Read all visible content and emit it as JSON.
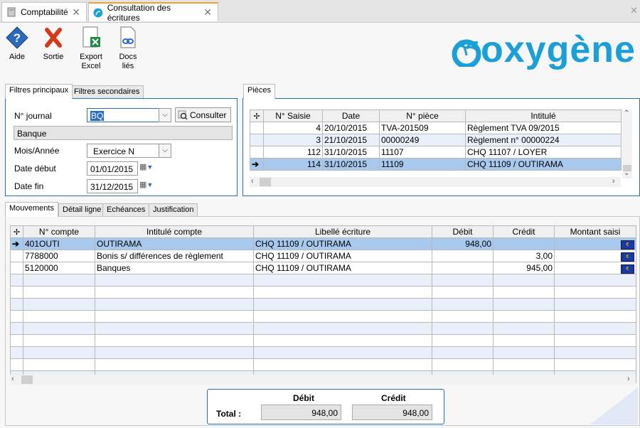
{
  "tabs": [
    {
      "label": "Comptabilité",
      "close": "✕"
    },
    {
      "label": "Consultation des écritures",
      "close": "✕"
    }
  ],
  "toolbar": [
    {
      "label1": "Aide",
      "label2": ""
    },
    {
      "label1": "Sortie",
      "label2": ""
    },
    {
      "label1": "Export",
      "label2": "Excel"
    },
    {
      "label1": "Docs",
      "label2": "liés"
    }
  ],
  "logo": "oxygène",
  "filters": {
    "tab_main": "Filtres principaux",
    "tab_secondary": "Filtres secondaires",
    "journal_label": "N° journal",
    "journal_value": "BQ",
    "consult_label": "Consulter",
    "journal_name": "Banque",
    "period_label": "Mois/Année",
    "period_value": "Exercice N",
    "start_label": "Date début",
    "start_value": "01/01/2015",
    "end_label": "Date fin",
    "end_value": "31/12/2015"
  },
  "pieces": {
    "tab": "Pièces",
    "headers": [
      "N° Saisie",
      "Date",
      "N° pièce",
      "Intitulé"
    ],
    "rows": [
      {
        "saisie": "4",
        "date": "20/10/2015",
        "piece": "TVA-201509",
        "intitule": "Règlement TVA 09/2015"
      },
      {
        "saisie": "3",
        "date": "21/10/2015",
        "piece": "00000249",
        "intitule": "Règlement n° 00000224"
      },
      {
        "saisie": "112",
        "date": "31/10/2015",
        "piece": "11107",
        "intitule": "CHQ 11107 / LOYER"
      },
      {
        "saisie": "114",
        "date": "31/10/2015",
        "piece": "11109",
        "intitule": "CHQ 11109 / OUTIRAMA"
      }
    ]
  },
  "lower_tabs": [
    "Mouvements",
    "Détail ligne",
    "Echéances",
    "Justification"
  ],
  "movements": {
    "headers": [
      "N° compte",
      "Intitulé compte",
      "Libellé écriture",
      "Débit",
      "Crédit",
      "Montant saisi"
    ],
    "rows": [
      {
        "compte": "401OUTI",
        "intitule": "OUTIRAMA",
        "libelle": "CHQ 11109 / OUTIRAMA",
        "debit": "948,00",
        "credit": ""
      },
      {
        "compte": "7788000",
        "intitule": "Bonis s/ différences de règlement",
        "libelle": "CHQ 11109 / OUTIRAMA",
        "debit": "",
        "credit": "3,00"
      },
      {
        "compte": "5120000",
        "intitule": "Banques",
        "libelle": "CHQ 11109 / OUTIRAMA",
        "debit": "",
        "credit": "945,00"
      }
    ],
    "flag_symbol": "€"
  },
  "totals": {
    "debit_label": "Débit",
    "credit_label": "Crédit",
    "total_label": "Total :",
    "debit_value": "948,00",
    "credit_value": "948,00"
  },
  "colors": {
    "accent": "#1e73b8",
    "selection": "#a8c8ee",
    "logo": "#1b9fd8"
  }
}
